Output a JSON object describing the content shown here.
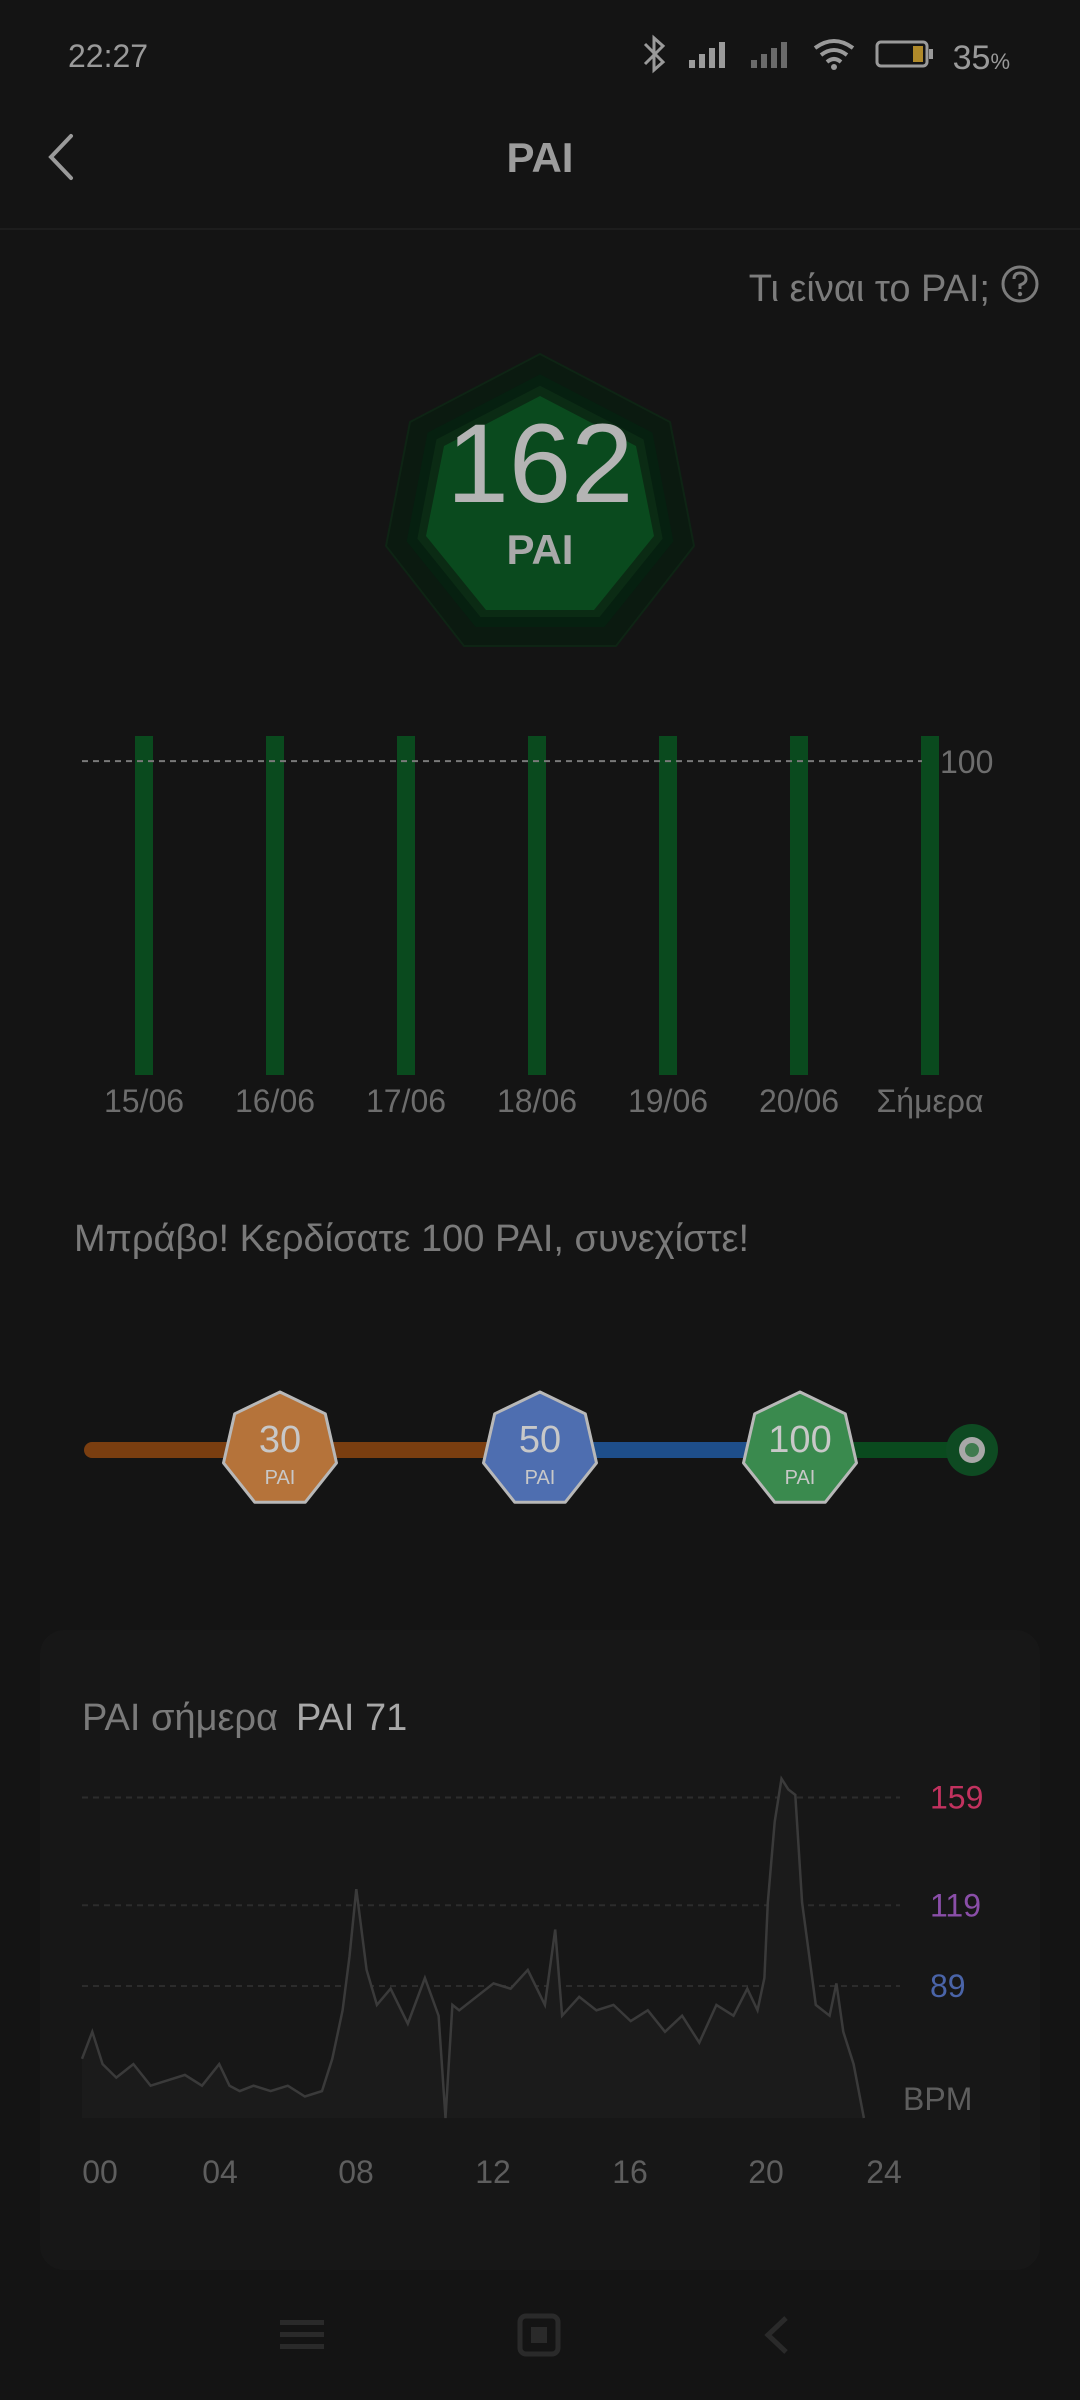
{
  "status": {
    "time": "22:27",
    "battery": "35",
    "battery_unit": "%"
  },
  "header": {
    "title": "PAI"
  },
  "help": {
    "label": "Τι είναι το PAI;"
  },
  "badge": {
    "value": "162",
    "unit": "PAI",
    "color": "#0a4a1e"
  },
  "weekly": {
    "reference_label": "100",
    "days": [
      "15/06",
      "16/06",
      "17/06",
      "18/06",
      "19/06",
      "20/06",
      "Σήμερα"
    ],
    "values": [
      108,
      108,
      108,
      108,
      108,
      108,
      108
    ],
    "ylim": [
      0,
      108
    ],
    "bar_color": "#0a4a1e"
  },
  "message": "Μπράβο! Κερδίσατε 100 PAI, συνεχίστε!",
  "levels": [
    {
      "value": "30",
      "unit": "PAI",
      "color": "#b5733a"
    },
    {
      "value": "50",
      "unit": "PAI",
      "color": "#4e6eb0"
    },
    {
      "value": "100",
      "unit": "PAI",
      "color": "#3a8a4e"
    }
  ],
  "today": {
    "label": "PAI σήμερα",
    "value": "PAI 71"
  },
  "chart_data": {
    "type": "line",
    "title": "PAI σήμερα",
    "ylabel": "BPM",
    "x_ticks": [
      "00",
      "04",
      "08",
      "12",
      "16",
      "20",
      "24"
    ],
    "xlim": [
      0,
      24
    ],
    "ylim": [
      40,
      167
    ],
    "thresholds": [
      {
        "value": 159,
        "label": "159",
        "color": "#c2325f"
      },
      {
        "value": 119,
        "label": "119",
        "color": "#8a4ea8"
      },
      {
        "value": 89,
        "label": "89",
        "color": "#4a64a8"
      }
    ],
    "x": [
      0,
      0.3,
      0.6,
      1.0,
      1.5,
      2.0,
      2.5,
      3.0,
      3.5,
      4.0,
      4.3,
      4.6,
      5.0,
      5.5,
      6.0,
      6.5,
      7.0,
      7.3,
      7.6,
      7.8,
      8.0,
      8.3,
      8.6,
      9.0,
      9.5,
      10.0,
      10.4,
      10.6,
      10.8,
      11.0,
      11.5,
      12.0,
      12.5,
      13.0,
      13.5,
      13.8,
      14.0,
      14.5,
      15.0,
      15.5,
      16.0,
      16.5,
      17.0,
      17.5,
      18.0,
      18.5,
      19.0,
      19.4,
      19.7,
      19.9,
      20.0,
      20.2,
      20.4,
      20.6,
      20.8,
      21.0,
      21.4,
      21.8,
      22.0,
      22.2,
      22.5,
      22.8
    ],
    "y": [
      62,
      72,
      60,
      55,
      60,
      52,
      54,
      56,
      52,
      60,
      52,
      50,
      52,
      50,
      52,
      48,
      50,
      62,
      80,
      100,
      125,
      95,
      82,
      88,
      75,
      92,
      78,
      40,
      82,
      80,
      85,
      90,
      88,
      95,
      82,
      110,
      78,
      85,
      80,
      82,
      76,
      80,
      72,
      78,
      68,
      82,
      78,
      88,
      80,
      92,
      120,
      150,
      166,
      162,
      160,
      120,
      82,
      78,
      90,
      72,
      60,
      40
    ]
  }
}
